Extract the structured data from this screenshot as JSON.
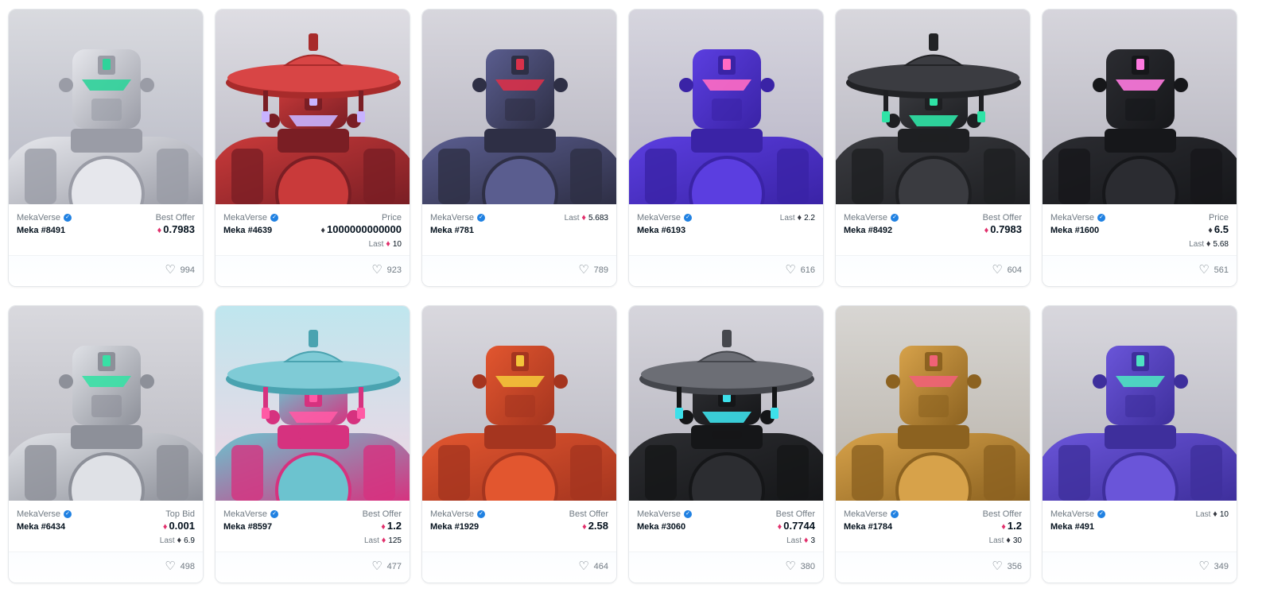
{
  "cards": [
    {
      "collection": "MekaVerse",
      "name": "Meka #8491",
      "label": "Best Offer",
      "value": "0.7983",
      "eth": "pink",
      "last": "",
      "last_eth": "",
      "likes": "994",
      "art": {
        "bg1": "#d9dadf",
        "bg2": "#b6b8c4",
        "body": "#e6e7ec",
        "dark": "#9a9ca6",
        "accent": "#2fd39a",
        "hat": "none"
      }
    },
    {
      "collection": "MekaVerse",
      "name": "Meka #4639",
      "label": "Price",
      "value": "1000000000000",
      "eth": "black",
      "last": "10",
      "last_eth": "pink",
      "likes": "923",
      "art": {
        "bg1": "#dedde3",
        "bg2": "#b9b8c3",
        "body": "#c93a3a",
        "dark": "#7a1e24",
        "accent": "#c8b3ff",
        "hat": "wide-red"
      }
    },
    {
      "collection": "MekaVerse",
      "name": "Meka #781",
      "label": "",
      "value": "",
      "eth": "",
      "last": "5.683",
      "last_eth": "pink",
      "likes": "789",
      "art": {
        "bg1": "#d7d6dd",
        "bg2": "#b4b2be",
        "body": "#5a5d8f",
        "dark": "#2e2f45",
        "accent": "#d8314a",
        "hat": "none"
      }
    },
    {
      "collection": "MekaVerse",
      "name": "Meka #6193",
      "label": "",
      "value": "",
      "eth": "",
      "last": "2.2",
      "last_eth": "black",
      "likes": "616",
      "art": {
        "bg1": "#d6d5de",
        "bg2": "#b6b3c5",
        "body": "#5b3ee0",
        "dark": "#3a23a6",
        "accent": "#ff6bc4",
        "hat": "none"
      }
    },
    {
      "collection": "MekaVerse",
      "name": "Meka #8492",
      "label": "Best Offer",
      "value": "0.7983",
      "eth": "pink",
      "last": "",
      "last_eth": "",
      "likes": "604",
      "art": {
        "bg1": "#d8d7dd",
        "bg2": "#b5b4be",
        "body": "#3a3b40",
        "dark": "#1e1f22",
        "accent": "#2fe3a6",
        "hat": "wide-dark"
      }
    },
    {
      "collection": "MekaVerse",
      "name": "Meka #1600",
      "label": "Price",
      "value": "6.5",
      "eth": "black",
      "last": "5.68",
      "last_eth": "black",
      "likes": "561",
      "art": {
        "bg1": "#d6d5dc",
        "bg2": "#b4b3bd",
        "body": "#2b2c31",
        "dark": "#16171a",
        "accent": "#ff7ae0",
        "hat": "none"
      }
    },
    {
      "collection": "MekaVerse",
      "name": "Meka #6434",
      "label": "Top Bid",
      "value": "0.001",
      "eth": "pink",
      "last": "6.9",
      "last_eth": "black",
      "likes": "498",
      "art": {
        "bg1": "#d9d9de",
        "bg2": "#b8b8c0",
        "body": "#dfe1e6",
        "dark": "#8d9099",
        "accent": "#38e0a5",
        "hat": "none"
      }
    },
    {
      "collection": "MekaVerse",
      "name": "Meka #8597",
      "label": "Best Offer",
      "value": "1.2",
      "eth": "pink",
      "last": "125",
      "last_eth": "pink",
      "likes": "477",
      "art": {
        "bg1": "#bfe6ee",
        "bg2": "#f3d5e3",
        "body": "#6cc3cf",
        "dark": "#d6327f",
        "accent": "#ff5aa5",
        "hat": "wide-teal"
      }
    },
    {
      "collection": "MekaVerse",
      "name": "Meka #1929",
      "label": "Best Offer",
      "value": "2.58",
      "eth": "pink",
      "last": "",
      "last_eth": "",
      "likes": "464",
      "art": {
        "bg1": "#d9d8de",
        "bg2": "#b7b6c0",
        "body": "#e2562f",
        "dark": "#a5351f",
        "accent": "#f3c43a",
        "hat": "none"
      }
    },
    {
      "collection": "MekaVerse",
      "name": "Meka #3060",
      "label": "Best Offer",
      "value": "0.7744",
      "eth": "pink",
      "last": "3",
      "last_eth": "pink",
      "likes": "380",
      "art": {
        "bg1": "#d6d5dc",
        "bg2": "#b3b2bc",
        "body": "#2c2d31",
        "dark": "#151618",
        "accent": "#3de0ea",
        "hat": "wide-grey"
      }
    },
    {
      "collection": "MekaVerse",
      "name": "Meka #1784",
      "label": "Best Offer",
      "value": "1.2",
      "eth": "pink",
      "last": "30",
      "last_eth": "black",
      "likes": "356",
      "art": {
        "bg1": "#d8d6d3",
        "bg2": "#b8b2a9",
        "body": "#d7a24a",
        "dark": "#8c6220",
        "accent": "#f06277",
        "hat": "none"
      }
    },
    {
      "collection": "MekaVerse",
      "name": "Meka #491",
      "label": "",
      "value": "",
      "eth": "",
      "last": "10",
      "last_eth": "black",
      "likes": "349",
      "art": {
        "bg1": "#d8d7dd",
        "bg2": "#b6b5bf",
        "body": "#6a55d9",
        "dark": "#3e2f9c",
        "accent": "#4ee2c2",
        "hat": "none"
      }
    }
  ],
  "icons": {
    "verified": "verified-check-icon",
    "eth": "ethereum-icon",
    "heart": "heart-outline-icon"
  },
  "colors": {
    "brand_blue": "#2081e2",
    "eth_pink": "#e1306c",
    "text_dark": "#04111d",
    "text_muted": "#707a83"
  }
}
